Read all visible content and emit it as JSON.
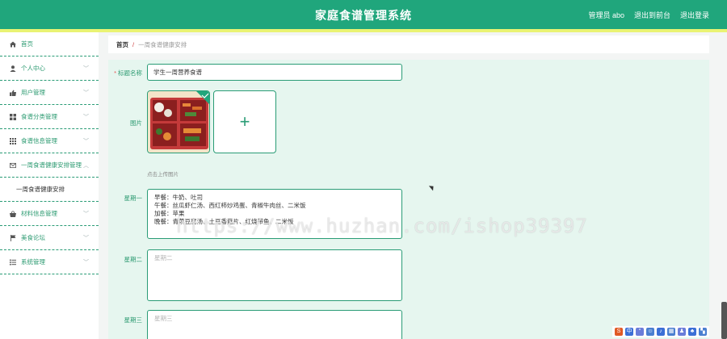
{
  "header": {
    "title": "家庭食谱管理系统",
    "links": [
      "管理员 abo",
      "退出到前台",
      "退出登录"
    ]
  },
  "sidebar": {
    "items": [
      {
        "label": "首页",
        "icon": "home-icon",
        "chevron": false
      },
      {
        "label": "个人中心",
        "icon": "user-icon",
        "chevron": true
      },
      {
        "label": "用户管理",
        "icon": "thumbs-up-icon",
        "chevron": true
      },
      {
        "label": "食谱分类管理",
        "icon": "grid-icon",
        "chevron": true
      },
      {
        "label": "食谱信息管理",
        "icon": "table-icon",
        "chevron": true
      },
      {
        "label": "一周食谱健康安排管理",
        "icon": "envelope-icon",
        "chevron": true,
        "expanded": true
      },
      {
        "label": "材料信息管理",
        "icon": "basket-icon",
        "chevron": true
      },
      {
        "label": "美食论坛",
        "icon": "flag-icon",
        "chevron": true
      },
      {
        "label": "系统管理",
        "icon": "list-icon",
        "chevron": true
      }
    ],
    "submenu": [
      "一周食谱健康安排"
    ]
  },
  "breadcrumb": {
    "home": "首页",
    "separator": "/",
    "current": "一周食谱健康安排"
  },
  "form": {
    "title_label": "标题名称",
    "title_value": "学生一周营养食谱",
    "image_label": "图片",
    "upload_tip": "点击上传图片",
    "monday_label": "星期一",
    "monday_lines": [
      "早餐：牛奶、吐司",
      "午餐：丝瓜虾仁汤、西红柿炒鸡蛋、青椒牛肉丝、二米饭",
      "加餐：苹果",
      "晚餐：青菜豆腐汤、土豆香菇片、红烧带鱼、二米饭"
    ],
    "tuesday_label": "星期二",
    "tuesday_placeholder": "星期二",
    "wednesday_label": "星期三",
    "wednesday_placeholder": "星期三"
  },
  "watermark": "https://www.huzhan.com/ishop39397",
  "colors": {
    "primary": "#20a67c",
    "accent_stripe": "#e9f373",
    "content_bg": "#e6f6ef"
  }
}
